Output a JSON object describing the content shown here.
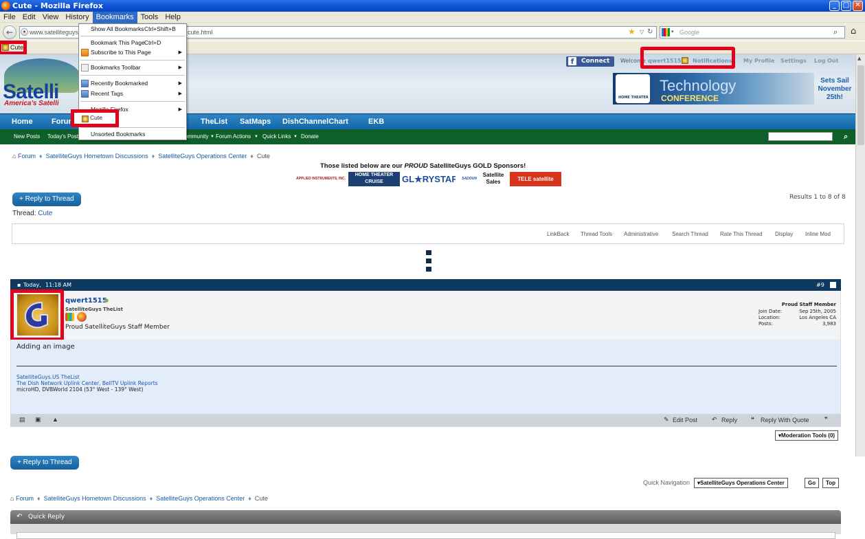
{
  "window": {
    "title": "Cute - Mozilla Firefox",
    "min": "_",
    "max": "□",
    "close": "✕"
  },
  "menubar": [
    "File",
    "Edit",
    "View",
    "History",
    "Bookmarks",
    "Tools",
    "Help"
  ],
  "nav": {
    "url_prefix": "www.satelliteguys.",
    "url_suffix": "cute.html",
    "search_placeholder": "Google"
  },
  "bookmarks_bar": {
    "item": "Cute"
  },
  "bookmarks_menu": {
    "show_all": "Show All Bookmarks",
    "show_all_sc": "Ctrl+Shift+B",
    "bookmark_page": "Bookmark This Page",
    "bookmark_page_sc": "Ctrl+D",
    "subscribe": "Subscribe to This Page",
    "toolbar": "Bookmarks Toolbar",
    "recent": "Recently Bookmarked",
    "tags": "Recent Tags",
    "mozilla": "Mozilla Firefox",
    "cute": "Cute",
    "unsorted": "Unsorted Bookmarks"
  },
  "header": {
    "logo": "Satelli",
    "logo_sub": "America's Satelli",
    "connect": "Connect",
    "welcome": "Welcome",
    "username": "qwert1515",
    "notifications": "Notifications",
    "profile": "My Profile",
    "settings": "Settings",
    "logout": "Log Out",
    "ad_badge": "HOME THEATER",
    "ad_title": "Technology",
    "ad_conf": "CONFERENCE",
    "ad_side": "Sets Sail November 25th!"
  },
  "mainnav": [
    "Home",
    "Forum",
    "TheList",
    "SatMaps",
    "DishChannelChart",
    "EKB"
  ],
  "subnav": [
    "New Posts",
    "Today's Posts",
    "Community",
    "Forum Actions",
    "Quick Links",
    "Donate"
  ],
  "breadcrumb": [
    "Forum",
    "SatelliteGuys Hometown Discussions",
    "SatelliteGuys Operations Center",
    "Cute"
  ],
  "sponsors": {
    "title_a": "Those listed below are our ",
    "title_b": "PROUD",
    "title_c": " SatelliteGuys GOLD Sponsors!",
    "logos": [
      "APPLIED INSTRUMENTS, INC.",
      "HOME THEATER CRUISE",
      "GL★RYSTAR",
      "SADOUN",
      "Satellite Sales",
      "TELE satellite"
    ]
  },
  "thread": {
    "reply_btn": "+ Reply to Thread",
    "results": "Results 1 to 8 of 8",
    "label": "Thread:",
    "name": "Cute",
    "tools": [
      "LinkBack",
      "Thread Tools",
      "Administrative",
      "Search Thread",
      "Rate This Thread",
      "Display",
      "Inline Mod"
    ]
  },
  "post": {
    "date": "Today,",
    "time": "11:18 AM",
    "number": "#9",
    "username": "qwert1515",
    "usertitle": "SatelliteGuys TheList",
    "rank": "Proud SatelliteGuys Staff Member",
    "staff": "Proud Staff Member",
    "join_label": "Join Date:",
    "join": "Sep 25th, 2005",
    "loc_label": "Location:",
    "loc": "Los Angeles CA",
    "posts_label": "Posts:",
    "posts": "3,983",
    "body": "Adding an image",
    "sig1": "SatelliteGuys.US TheList",
    "sig2": "The Dish Network Uplink Center, BellTV Uplink Reports",
    "sig3": "microHD, DVBWorld 2104 (53° West - 139° West)",
    "edit": "Edit Post",
    "reply": "Reply",
    "reply_quote": "Reply With Quote",
    "moderation": "Moderation Tools (0)"
  },
  "bottom": {
    "quicknav": "Quick Navigation",
    "quicknav_sel": "SatelliteGuys Operations Center",
    "go": "Go",
    "top": "Top",
    "quick_reply": "Quick Reply"
  }
}
